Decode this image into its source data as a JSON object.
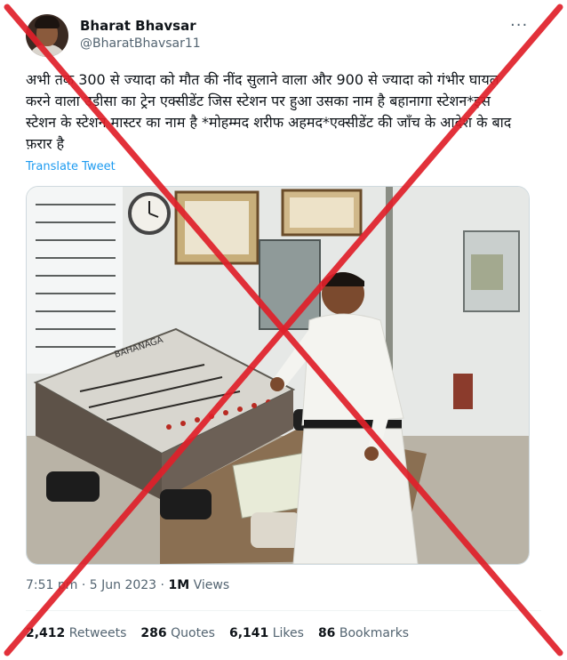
{
  "author": {
    "name": "Bharat Bhavsar",
    "handle": "@BharatBhavsar11"
  },
  "more_label": "···",
  "tweet_text": "अभी तक 300 से ज्यादा को मौत की नींद सुलाने वाला और 900 से ज्यादा को गंभीर घायल करने वाला उड़ीसा का ट्रेन एक्सीडेंट जिस स्टेशन पर हुआ उसका नाम है बहानागा स्टेशन*इस स्टेशन के स्टेशन मास्टर का नाम  है *मोहम्मद शरीफ अहमद*एक्सीडेंट की जाँच के आदेश के बाद फ़रार है",
  "translate_label": "Translate Tweet",
  "media": {
    "panel_sign": "BAHANAGA"
  },
  "meta": {
    "time": "7:51 pm",
    "sep1": " · ",
    "date": "5 Jun 2023",
    "sep2": " · ",
    "views_count": "1M",
    "views_label": " Views"
  },
  "stats": {
    "retweets_count": "2,412",
    "retweets_label": "Retweets",
    "quotes_count": "286",
    "quotes_label": "Quotes",
    "likes_count": "6,141",
    "likes_label": "Likes",
    "bookmarks_count": "86",
    "bookmarks_label": "Bookmarks"
  },
  "colors": {
    "accent": "#1d9bf0",
    "cross": "#e0202a"
  }
}
